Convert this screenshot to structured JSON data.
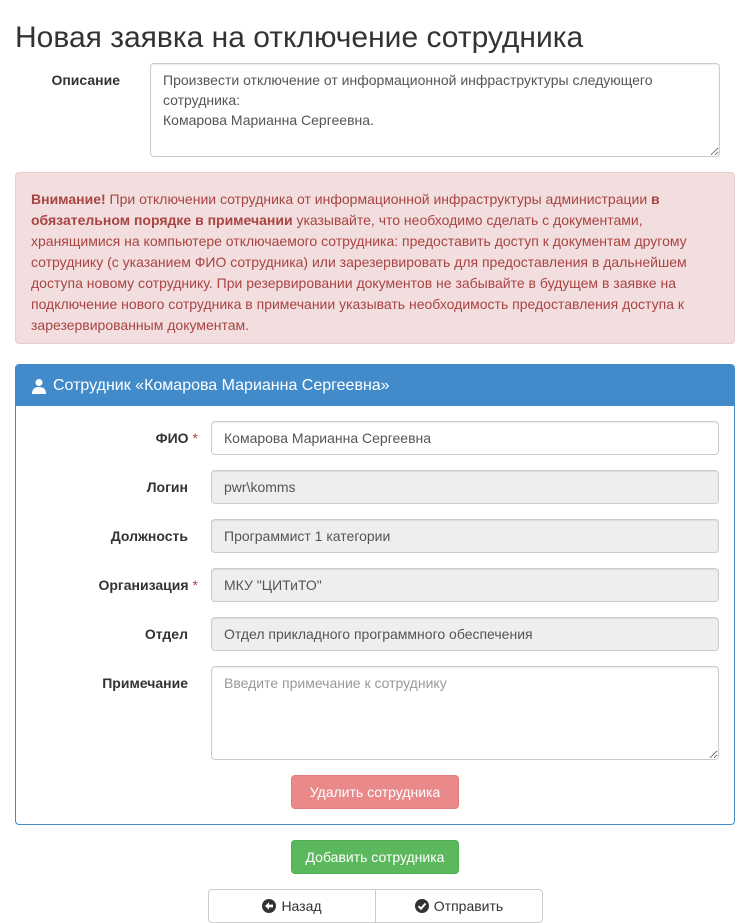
{
  "page": {
    "title": "Новая заявка на отключение сотрудника"
  },
  "description": {
    "label": "Описание",
    "value": "Произвести отключение от информационной инфраструктуры следующего сотрудника:\nКомарова Марианна Сергеевна."
  },
  "alert": {
    "strong": "Внимание!",
    "text1": " При отключении сотрудника от информационной инфраструктуры администрации ",
    "bold": "в обязательном порядке в примечании",
    "text2": " указывайте, что необходимо сделать с документами, хранящимися на компьютере отключаемого сотрудника: предоставить доступ к документам другому сотруднику (с указанием ФИО сотрудника) или зарезервировать для предоставления в дальнейшем доступа новому сотруднику. При резервировании документов не забывайте в будущем в заявке на подключение нового сотрудника в примечании указывать необходимость предоставления доступа к зарезервированным документам.",
    "colors": {
      "background": "#f2dede",
      "text": "#a94442"
    }
  },
  "employee_panel": {
    "title": "Сотрудник «Комарова Марианна Сергеевна»",
    "accent": "#428bca",
    "icon": "user-icon",
    "fields": {
      "fio": {
        "label": "ФИО",
        "required_mark": "*",
        "value": "Комарова Марианна Сергеевна"
      },
      "login": {
        "label": "Логин",
        "value": "pwr\\komms"
      },
      "position": {
        "label": "Должность",
        "value": "Программист 1 категории"
      },
      "organization": {
        "label": "Организация",
        "required_mark": "*",
        "value": "МКУ \"ЦИТиТО\""
      },
      "department": {
        "label": "Отдел",
        "value": "Отдел прикладного программного обеспечения"
      },
      "note": {
        "label": "Примечание",
        "placeholder": "Введите примечание к сотруднику",
        "value": ""
      }
    },
    "remove_button": "Удалить сотрудника"
  },
  "add_button": "Добавить сотрудника",
  "footer": {
    "back_label": "Назад",
    "back_icon": "arrow-left-circle-icon",
    "submit_label": "Отправить",
    "submit_icon": "check-circle-icon"
  }
}
